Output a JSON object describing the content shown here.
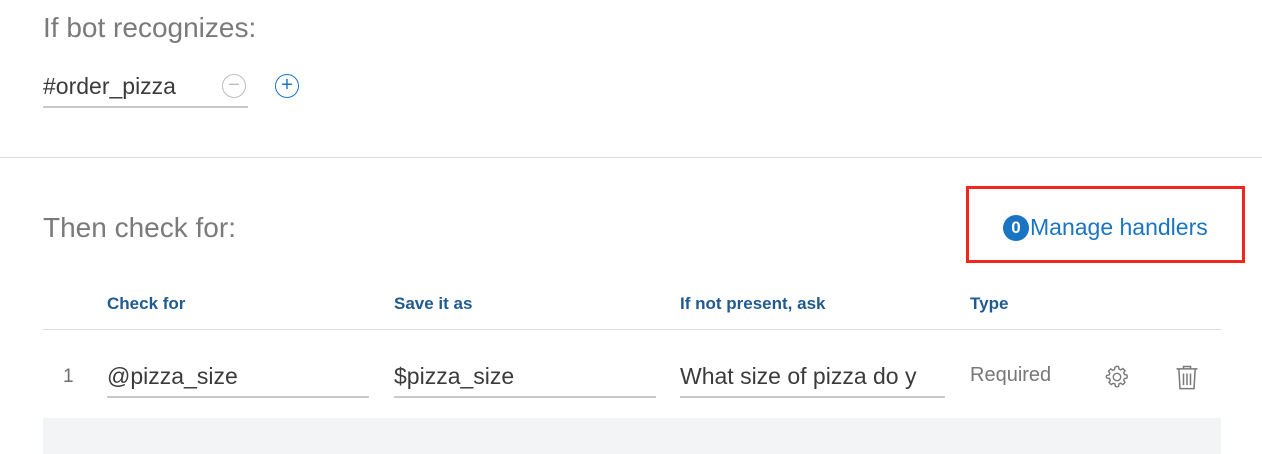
{
  "condition": {
    "heading": "If bot recognizes:",
    "intent_value": "#order_pizza"
  },
  "slots": {
    "heading": "Then check for:",
    "manage_handlers": {
      "count": "0",
      "label": "Manage handlers"
    },
    "columns": {
      "check_for": "Check for",
      "save_as": "Save it as",
      "ask": "If not present, ask",
      "type": "Type"
    },
    "rows": [
      {
        "index": "1",
        "check_for": "@pizza_size",
        "save_as": "$pizza_size",
        "ask": "What size of pizza do y",
        "type": "Required"
      }
    ]
  },
  "colors": {
    "accent": "#1a74c4",
    "header_text": "#1f5a91",
    "highlight": "#f2261c"
  }
}
